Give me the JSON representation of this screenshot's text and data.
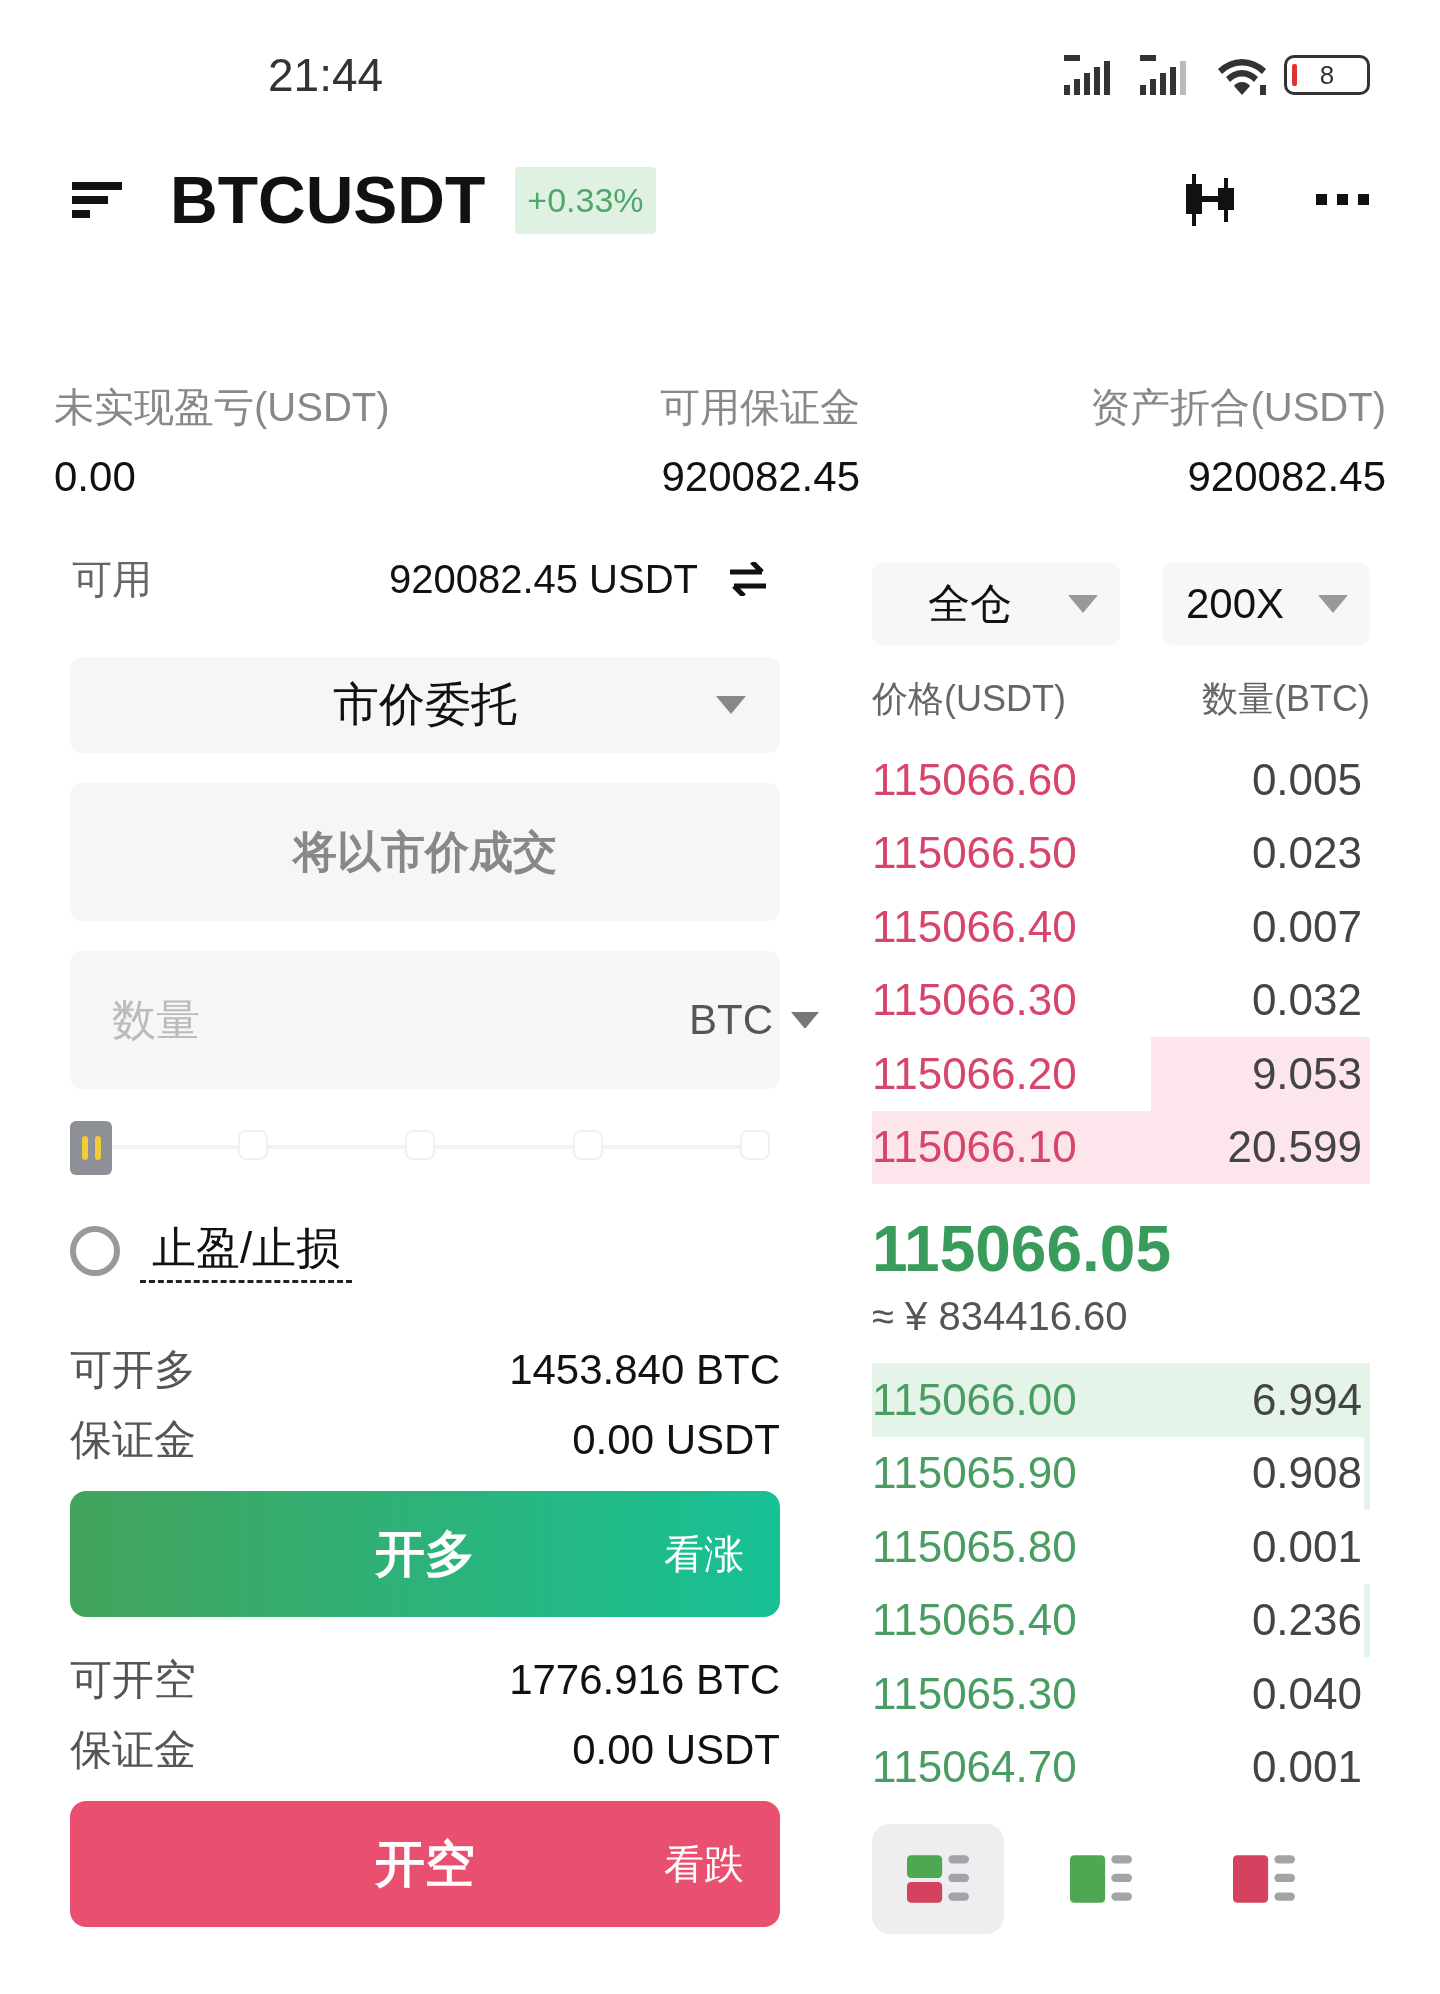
{
  "status_bar": {
    "time": "21:44",
    "battery": "8"
  },
  "header": {
    "symbol": "BTCUSDT",
    "change": "+0.33%"
  },
  "summary": [
    {
      "label": "未实现盈亏(USDT)",
      "value": "0.00"
    },
    {
      "label": "可用保证金",
      "value": "920082.45"
    },
    {
      "label": "资产折合(USDT)",
      "value": "920082.45"
    }
  ],
  "order_form": {
    "available_label": "可用",
    "available_value": "920082.45 USDT",
    "order_type": "市价委托",
    "price_field": {
      "placeholder": "将以市价成交"
    },
    "quantity_field": {
      "placeholder": "数量",
      "unit": "BTC"
    },
    "tp_sl": {
      "label": "止盈/止损",
      "checked": false
    },
    "long": {
      "rows": [
        {
          "label": "可开多",
          "value": "1453.840 BTC"
        },
        {
          "label": "保证金",
          "value": "0.00 USDT"
        }
      ],
      "button": "开多",
      "hint": "看涨"
    },
    "short": {
      "rows": [
        {
          "label": "可开空",
          "value": "1776.916 BTC"
        },
        {
          "label": "保证金",
          "value": "0.00 USDT"
        }
      ],
      "button": "开空",
      "hint": "看跌"
    }
  },
  "order_book": {
    "margin_mode": "全仓",
    "leverage": "200X",
    "columns": [
      "价格(USDT)",
      "数量(BTC)"
    ],
    "asks": [
      {
        "kind": "plain",
        "price": "115066.60",
        "amount": "0.005"
      },
      {
        "kind": "plain",
        "price": "115066.50",
        "amount": "0.023"
      },
      {
        "kind": "plain",
        "price": "115066.40",
        "amount": "0.007"
      },
      {
        "kind": "plain",
        "price": "115066.30",
        "amount": "0.032"
      },
      {
        "kind": "halfbar",
        "price": "115066.20",
        "amount": "9.053"
      },
      {
        "kind": "fullbar",
        "price": "115066.10",
        "amount": "20.599"
      }
    ],
    "last_price": "115066.05",
    "last_price_cny": "≈ ¥ 834416.60",
    "bids": [
      {
        "kind": "fullbar",
        "price": "115066.00",
        "amount": "6.994"
      },
      {
        "kind": "sliver",
        "price": "115065.90",
        "amount": "0.908"
      },
      {
        "kind": "plain",
        "price": "115065.80",
        "amount": "0.001"
      },
      {
        "kind": "sliver",
        "price": "115065.40",
        "amount": "0.236"
      },
      {
        "kind": "plain",
        "price": "115065.30",
        "amount": "0.040"
      },
      {
        "kind": "plain",
        "price": "115064.70",
        "amount": "0.001"
      }
    ],
    "views": [
      {
        "kind": "both",
        "selected": true
      },
      {
        "kind": "bids",
        "selected": false
      },
      {
        "kind": "asks",
        "selected": false
      }
    ]
  }
}
